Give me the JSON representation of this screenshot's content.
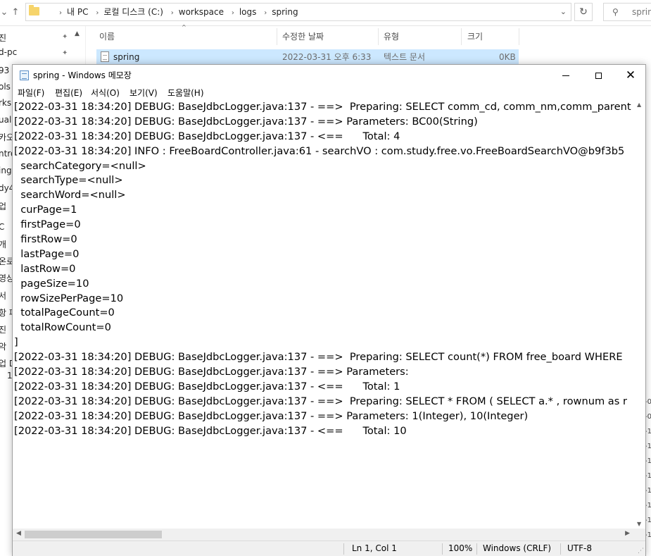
{
  "explorer": {
    "breadcrumb": [
      "내 PC",
      "로컬 디스크 (C:)",
      "workspace",
      "logs",
      "spring"
    ],
    "search_placeholder": "sprin",
    "nav_items": [
      "진",
      "d-pc",
      "93",
      "ols",
      "rksp",
      "ual",
      "카오",
      "ntro",
      "ing",
      "dy4",
      "업",
      "C",
      "개",
      "온로",
      "영상",
      "서",
      "항 파",
      "진",
      "악",
      "업 D",
      "1"
    ],
    "columns": {
      "name": "이름",
      "modified": "수정한 날짜",
      "type": "유형",
      "size": "크기"
    },
    "file": {
      "name": "spring",
      "modified": "2022-03-31 오후 6:33",
      "type": "텍스트 문서",
      "size": "0KB"
    },
    "right_marks": [
      "-0",
      "-0",
      "-1",
      "-1",
      "-1",
      "-1",
      "-1",
      "-1",
      "-1",
      "-1",
      "-1"
    ]
  },
  "notepad": {
    "title": "spring - Windows 메모장",
    "menu": [
      "파일(F)",
      "편집(E)",
      "서식(O)",
      "보기(V)",
      "도움말(H)"
    ],
    "lines": [
      "[2022-03-31 18:34:20] DEBUG: BaseJdbcLogger.java:137 - ==>  Preparing: SELECT comm_cd, comm_nm,comm_parent",
      "[2022-03-31 18:34:20] DEBUG: BaseJdbcLogger.java:137 - ==> Parameters: BC00(String)",
      "[2022-03-31 18:34:20] DEBUG: BaseJdbcLogger.java:137 - <==      Total: 4",
      "[2022-03-31 18:34:20] INFO : FreeBoardController.java:61 - searchVO : com.study.free.vo.FreeBoardSearchVO@b9f3b5",
      "  searchCategory=<null>",
      "  searchType=<null>",
      "  searchWord=<null>",
      "  curPage=1",
      "  firstPage=0",
      "  firstRow=0",
      "  lastPage=0",
      "  lastRow=0",
      "  pageSize=10",
      "  rowSizePerPage=10",
      "  totalPageCount=0",
      "  totalRowCount=0",
      "]",
      "[2022-03-31 18:34:20] DEBUG: BaseJdbcLogger.java:137 - ==>  Preparing: SELECT count(*) FROM free_board WHERE",
      "[2022-03-31 18:34:20] DEBUG: BaseJdbcLogger.java:137 - ==> Parameters: ",
      "[2022-03-31 18:34:20] DEBUG: BaseJdbcLogger.java:137 - <==      Total: 1",
      "[2022-03-31 18:34:20] DEBUG: BaseJdbcLogger.java:137 - ==>  Preparing: SELECT * FROM ( SELECT a.* , rownum as r",
      "[2022-03-31 18:34:20] DEBUG: BaseJdbcLogger.java:137 - ==> Parameters: 1(Integer), 10(Integer)",
      "[2022-03-31 18:34:20] DEBUG: BaseJdbcLogger.java:137 - <==      Total: 10"
    ],
    "status": {
      "position": "Ln 1, Col 1",
      "zoom": "100%",
      "line_ending": "Windows (CRLF)",
      "encoding": "UTF-8"
    }
  }
}
